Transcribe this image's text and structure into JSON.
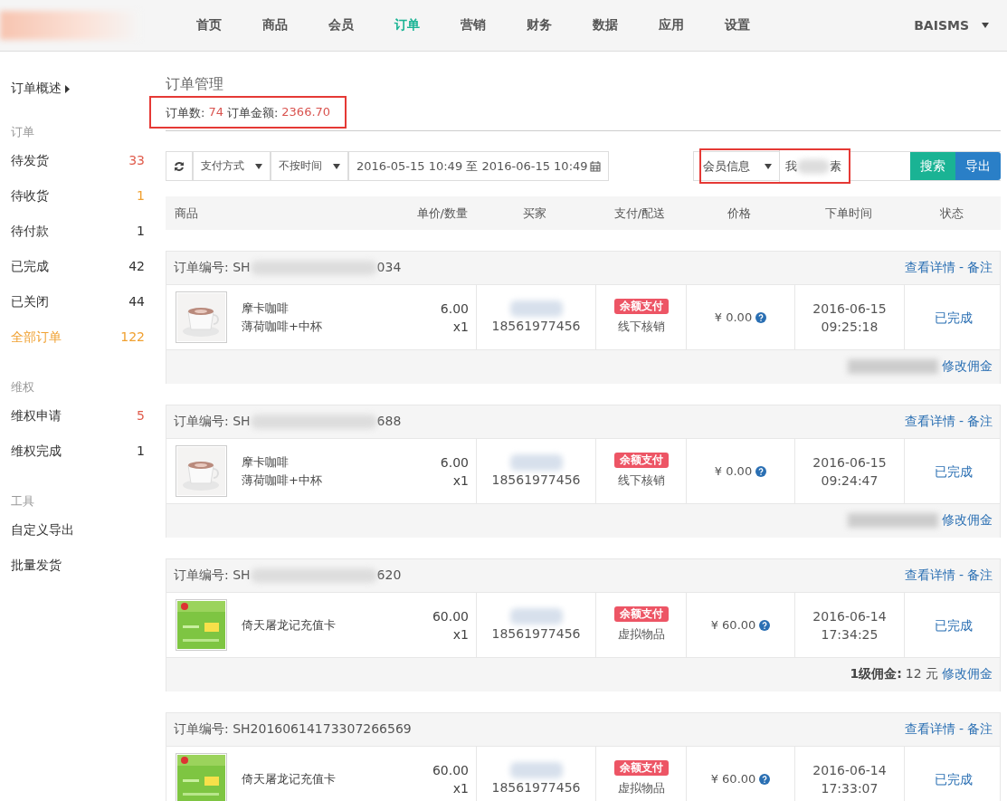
{
  "nav": {
    "items": [
      {
        "label": "首页",
        "selected": false
      },
      {
        "label": "商品",
        "selected": false
      },
      {
        "label": "会员",
        "selected": false
      },
      {
        "label": "订单",
        "selected": true
      },
      {
        "label": "营销",
        "selected": false
      },
      {
        "label": "财务",
        "selected": false
      },
      {
        "label": "数据",
        "selected": false
      },
      {
        "label": "应用",
        "selected": false
      },
      {
        "label": "设置",
        "selected": false
      }
    ],
    "user": "BAISMS"
  },
  "sidebar": {
    "top": "订单概述",
    "sections": [
      {
        "title": "订单",
        "items": [
          {
            "label": "待发货",
            "count": "33",
            "color": "#e05b4b",
            "selected": false
          },
          {
            "label": "待收货",
            "count": "1",
            "color": "#f0a030",
            "selected": false
          },
          {
            "label": "待付款",
            "count": "1",
            "selected": false
          },
          {
            "label": "已完成",
            "count": "42",
            "selected": false
          },
          {
            "label": "已关闭",
            "count": "44",
            "selected": false
          },
          {
            "label": "全部订单",
            "count": "122",
            "color": "#f0a030",
            "selected": true
          }
        ]
      },
      {
        "title": "维权",
        "items": [
          {
            "label": "维权申请",
            "count": "5",
            "color": "#e05b4b",
            "selected": false
          },
          {
            "label": "维权完成",
            "count": "1",
            "selected": false
          }
        ]
      },
      {
        "title": "工具",
        "items": [
          {
            "label": "自定义导出",
            "selected": false
          },
          {
            "label": "批量发货",
            "selected": false
          }
        ]
      }
    ]
  },
  "page": {
    "title": "订单管理",
    "summary": [
      {
        "label": "订单数:",
        "value": "74"
      },
      {
        "label": "订单金额:",
        "value": "2366.70"
      }
    ]
  },
  "toolbar": {
    "pay_method": "支付方式",
    "time_filter": "不按时间",
    "date_range": "2016-05-15 10:49 至 2016-06-15 10:49",
    "search_type": "会员信息",
    "search_value_start": "我",
    "search_value_end": "素",
    "search_button": "搜索",
    "export_button": "导出"
  },
  "table": {
    "columns": [
      "商品",
      "单价/数量",
      "买家",
      "支付/配送",
      "价格",
      "下单时间",
      "状态"
    ],
    "orders": [
      {
        "number_start": "订单编号: SH",
        "number_end": "034",
        "links": [
          "查看详情",
          "备注"
        ],
        "separator": "-",
        "product": "摩卡咖啡",
        "variant": "薄荷咖啡+中杯",
        "unit_price": "6.00",
        "qty": "x1",
        "phone": "18561977456",
        "pay_tag": "余额支付",
        "delivery": "线下核销",
        "price": "¥ 0.00",
        "date": "2016-06-15",
        "time": "09:25:18",
        "status": "已完成",
        "commission": {
          "kind": "redacted",
          "link": "修改佣金"
        }
      },
      {
        "number_start": "订单编号: SH",
        "number_end": "688",
        "links": [
          "查看详情",
          "备注"
        ],
        "separator": "-",
        "product": "摩卡咖啡",
        "variant": "薄荷咖啡+中杯",
        "unit_price": "6.00",
        "qty": "x1",
        "phone": "18561977456",
        "pay_tag": "余额支付",
        "delivery": "线下核销",
        "price": "¥ 0.00",
        "date": "2016-06-15",
        "time": "09:24:47",
        "status": "已完成",
        "commission": {
          "kind": "redacted",
          "link": "修改佣金"
        }
      },
      {
        "number_start": "订单编号: SH",
        "number_end": "620",
        "links": [
          "查看详情",
          "备注"
        ],
        "separator": "-",
        "product": "倚天屠龙记充值卡",
        "unit_price": "60.00",
        "qty": "x1",
        "phone": "18561977456",
        "pay_tag": "余额支付",
        "delivery": "虚拟物品",
        "price": "¥ 60.00",
        "date": "2016-06-14",
        "time": "17:34:25",
        "status": "已完成",
        "commission": {
          "kind": "shown",
          "label": "1级佣金:",
          "amount": "12 元",
          "link": "修改佣金"
        }
      },
      {
        "number_start": "订单编号: SH20160614173307266569",
        "links": [
          "查看详情",
          "备注"
        ],
        "separator": "-",
        "product": "倚天屠龙记充值卡",
        "unit_price": "60.00",
        "qty": "x1",
        "phone": "18561977456",
        "pay_tag": "余额支付",
        "delivery": "虚拟物品",
        "price": "¥ 60.00",
        "date": "2016-06-14",
        "time": "17:33:07",
        "status": "已完成"
      }
    ]
  }
}
